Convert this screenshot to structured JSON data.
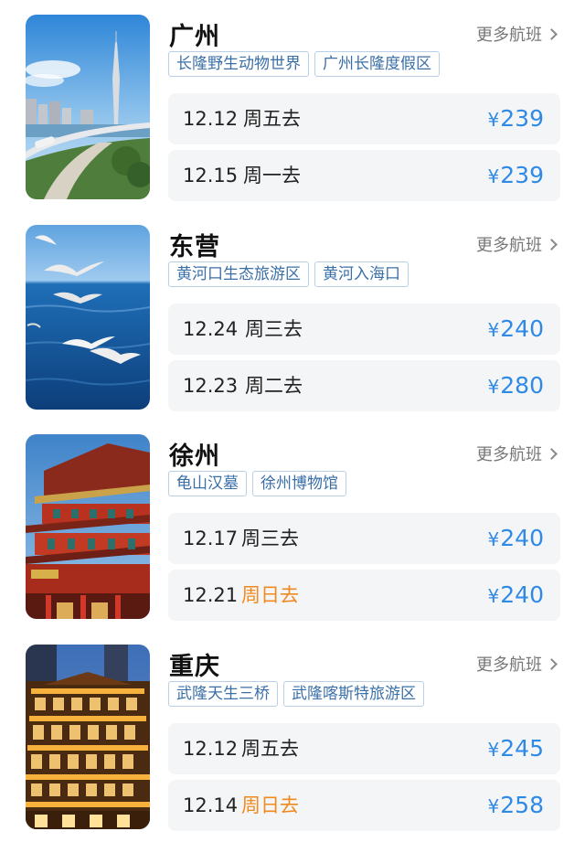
{
  "more_label": "更多航班",
  "currency_symbol": "¥",
  "destinations": [
    {
      "city": "广州",
      "image": "canton-tower-photo",
      "tags": [
        "长隆野生动物世界",
        "广州长隆度假区"
      ],
      "flights": [
        {
          "date": "12.12",
          "day": "周五去",
          "price": "239",
          "weekend": false
        },
        {
          "date": "12.15",
          "day": "周一去",
          "price": "239",
          "weekend": false
        }
      ]
    },
    {
      "city": "东营",
      "image": "seagulls-over-sea-photo",
      "tags": [
        "黄河口生态旅游区",
        "黄河入海口"
      ],
      "flights": [
        {
          "date": "12.24",
          "day": "周三去",
          "price": "240",
          "weekend": false
        },
        {
          "date": "12.23",
          "day": "周二去",
          "price": "280",
          "weekend": false
        }
      ]
    },
    {
      "city": "徐州",
      "image": "red-pagoda-temple-photo",
      "tags": [
        "龟山汉墓",
        "徐州博物馆"
      ],
      "flights": [
        {
          "date": "12.17",
          "day": "周三去",
          "price": "240",
          "weekend": false
        },
        {
          "date": "12.21",
          "day": "周日去",
          "price": "240",
          "weekend": true
        }
      ]
    },
    {
      "city": "重庆",
      "image": "hongyadong-night-photo",
      "tags": [
        "武隆天生三桥",
        "武隆喀斯特旅游区"
      ],
      "flights": [
        {
          "date": "12.12",
          "day": "周五去",
          "price": "245",
          "weekend": false
        },
        {
          "date": "12.14",
          "day": "周日去",
          "price": "258",
          "weekend": true
        }
      ]
    }
  ],
  "colors": {
    "price": "#2f8ae6",
    "weekend_day": "#f08a1f",
    "tag_text": "#3a6fa8",
    "tag_border": "#b9cfe6",
    "row_bg": "#f4f5f7"
  }
}
